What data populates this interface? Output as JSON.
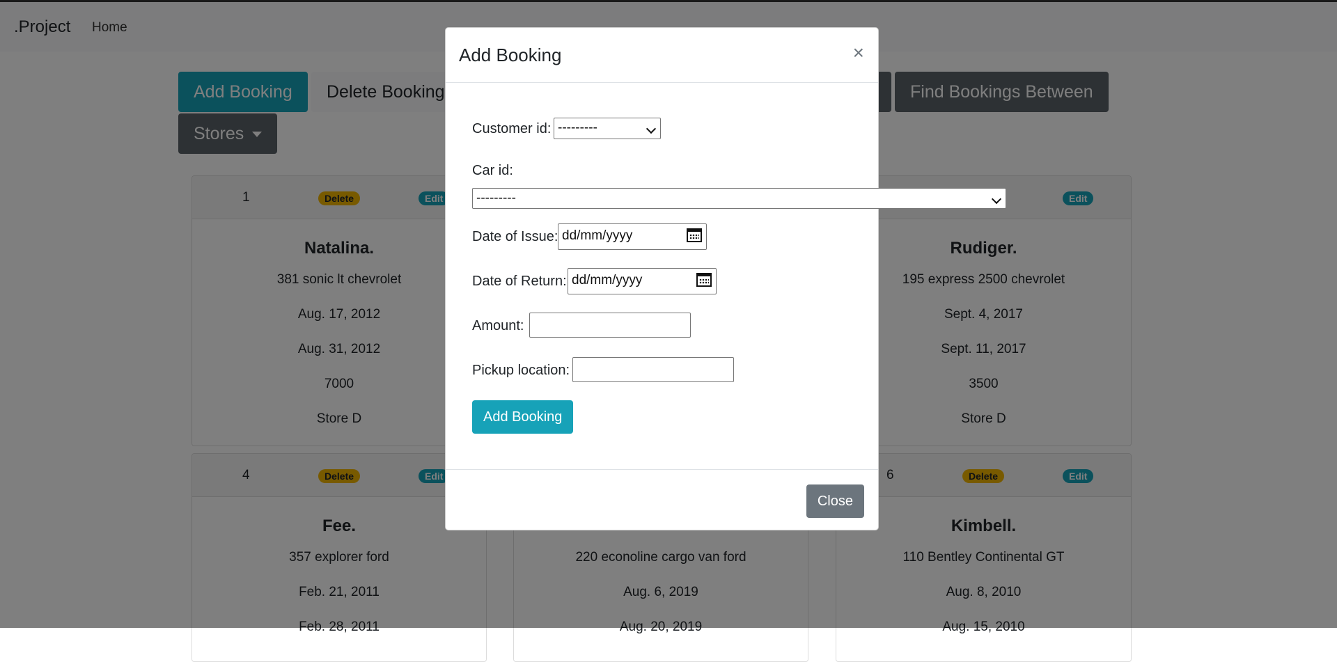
{
  "navbar": {
    "brand": ".Project",
    "home": "Home"
  },
  "toolbar": {
    "add_booking": "Add Booking",
    "delete_booking": "Delete Booking",
    "find_between": "Find Bookings Between",
    "stores": "Stores"
  },
  "badges": {
    "delete": "Delete",
    "edit": "Edit"
  },
  "cards": [
    {
      "id": "1",
      "name": "Natalina.",
      "car": "381 sonic lt chevrolet",
      "issue": "Aug. 17, 2012",
      "return": "Aug. 31, 2012",
      "amount": "7000",
      "store": "Store D"
    },
    {
      "id": "",
      "name": "Rudiger.",
      "car": "195 express 2500 chevrolet",
      "issue": "Sept. 4, 2017",
      "return": "Sept. 11, 2017",
      "amount": "3500",
      "store": "Store D"
    },
    {
      "id": "4",
      "name": "Fee.",
      "car": "357 explorer ford",
      "issue": "Feb. 21, 2011",
      "return": "Feb. 28, 2011"
    },
    {
      "id": "",
      "name": "",
      "car": "220 econoline cargo van ford",
      "issue": "Aug. 6, 2019",
      "return": "Aug. 20, 2019"
    },
    {
      "id": "6",
      "name": "Kimbell.",
      "car": "110 Bentley Continental GT",
      "issue": "Aug. 8, 2010",
      "return": "Aug. 15, 2010"
    }
  ],
  "modal": {
    "title": "Add Booking",
    "close_glyph": "×",
    "customer_label": "Customer id:",
    "customer_value": "---------",
    "car_label": "Car id:",
    "car_value": "---------",
    "issue_label": "Date of Issue:",
    "issue_placeholder": "dd/mm/yyyy",
    "return_label": "Date of Return:",
    "return_placeholder": "dd/mm/yyyy",
    "amount_label": "Amount:",
    "amount_value": "",
    "pickup_label": "Pickup location:",
    "pickup_value": "",
    "submit": "Add Booking",
    "close": "Close"
  }
}
